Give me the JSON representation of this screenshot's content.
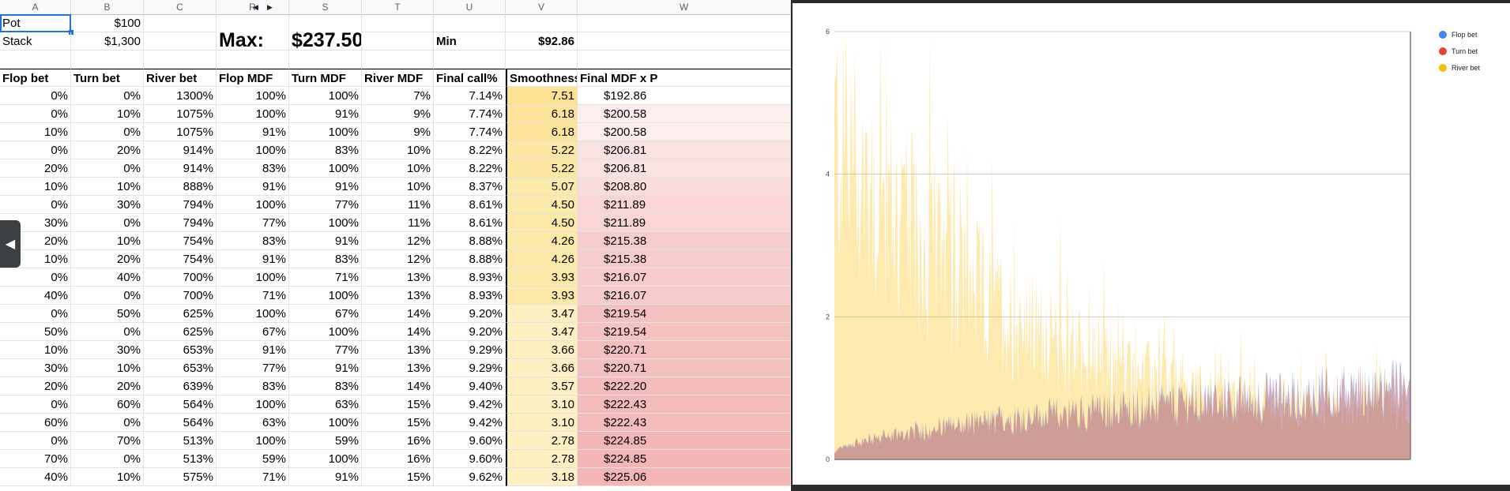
{
  "sheet": {
    "col_headers": [
      "A",
      "B",
      "C",
      "R",
      "S",
      "T",
      "U",
      "V",
      "W"
    ],
    "pot_label": "Pot",
    "pot_value": "$100",
    "stack_label": "Stack",
    "stack_value": "$1,300",
    "max_label": "Max:",
    "max_value": "$237.50",
    "min_label": "Min",
    "min_value": "$92.86",
    "table_headers": [
      "Flop bet",
      "Turn bet",
      "River bet",
      "Flop MDF",
      "Turn MDF",
      "River MDF",
      "Final call%",
      "Smoothness",
      "Final MDF x P"
    ],
    "rows": [
      [
        "0%",
        "0%",
        "1300%",
        "100%",
        "100%",
        "7%",
        "7.14%",
        "7.51",
        "$192.86"
      ],
      [
        "0%",
        "10%",
        "1075%",
        "100%",
        "91%",
        "9%",
        "7.74%",
        "6.18",
        "$200.58"
      ],
      [
        "10%",
        "0%",
        "1075%",
        "91%",
        "100%",
        "9%",
        "7.74%",
        "6.18",
        "$200.58"
      ],
      [
        "0%",
        "20%",
        "914%",
        "100%",
        "83%",
        "10%",
        "8.22%",
        "5.22",
        "$206.81"
      ],
      [
        "20%",
        "0%",
        "914%",
        "83%",
        "100%",
        "10%",
        "8.22%",
        "5.22",
        "$206.81"
      ],
      [
        "10%",
        "10%",
        "888%",
        "91%",
        "91%",
        "10%",
        "8.37%",
        "5.07",
        "$208.80"
      ],
      [
        "0%",
        "30%",
        "794%",
        "100%",
        "77%",
        "11%",
        "8.61%",
        "4.50",
        "$211.89"
      ],
      [
        "30%",
        "0%",
        "794%",
        "77%",
        "100%",
        "11%",
        "8.61%",
        "4.50",
        "$211.89"
      ],
      [
        "20%",
        "10%",
        "754%",
        "83%",
        "91%",
        "12%",
        "8.88%",
        "4.26",
        "$215.38"
      ],
      [
        "10%",
        "20%",
        "754%",
        "91%",
        "83%",
        "12%",
        "8.88%",
        "4.26",
        "$215.38"
      ],
      [
        "0%",
        "40%",
        "700%",
        "100%",
        "71%",
        "13%",
        "8.93%",
        "3.93",
        "$216.07"
      ],
      [
        "40%",
        "0%",
        "700%",
        "71%",
        "100%",
        "13%",
        "8.93%",
        "3.93",
        "$216.07"
      ],
      [
        "0%",
        "50%",
        "625%",
        "100%",
        "67%",
        "14%",
        "9.20%",
        "3.47",
        "$219.54"
      ],
      [
        "50%",
        "0%",
        "625%",
        "67%",
        "100%",
        "14%",
        "9.20%",
        "3.47",
        "$219.54"
      ],
      [
        "10%",
        "30%",
        "653%",
        "91%",
        "77%",
        "13%",
        "9.29%",
        "3.66",
        "$220.71"
      ],
      [
        "30%",
        "10%",
        "653%",
        "77%",
        "91%",
        "13%",
        "9.29%",
        "3.66",
        "$220.71"
      ],
      [
        "20%",
        "20%",
        "639%",
        "83%",
        "83%",
        "14%",
        "9.40%",
        "3.57",
        "$222.20"
      ],
      [
        "0%",
        "60%",
        "564%",
        "100%",
        "63%",
        "15%",
        "9.42%",
        "3.10",
        "$222.43"
      ],
      [
        "60%",
        "0%",
        "564%",
        "63%",
        "100%",
        "15%",
        "9.42%",
        "3.10",
        "$222.43"
      ],
      [
        "0%",
        "70%",
        "513%",
        "100%",
        "59%",
        "16%",
        "9.60%",
        "2.78",
        "$224.85"
      ],
      [
        "70%",
        "0%",
        "513%",
        "59%",
        "100%",
        "16%",
        "9.60%",
        "2.78",
        "$224.85"
      ],
      [
        "40%",
        "10%",
        "575%",
        "71%",
        "91%",
        "15%",
        "9.62%",
        "3.18",
        "$225.06"
      ]
    ],
    "smooth_colors": [
      "#fde293",
      "#fee49a",
      "#fee49a",
      "#fee6a3",
      "#fee6a3",
      "#feeaa8",
      "#feeaa8",
      "#feeaa8",
      "#feeaa8",
      "#feeaa8",
      "#feeaa8",
      "#feeaa8",
      "#fef0c3",
      "#fef0c3",
      "#fef0c3",
      "#fef0c3",
      "#fef0c3",
      "#fef0c3",
      "#fef0c3",
      "#fef0c3",
      "#fef0c3",
      "#fef0c3"
    ],
    "mdf_colors": [
      "#ffffff",
      "#fdeeee",
      "#fdeeee",
      "#fbe2e2",
      "#fbe2e2",
      "#fadcdc",
      "#f9d5d5",
      "#f9d5d5",
      "#f7cccc",
      "#f7cccc",
      "#f7cbcb",
      "#f7cbcb",
      "#f5c2c2",
      "#f5c2c2",
      "#f4bfbf",
      "#f4bfbf",
      "#f4bcbc",
      "#f4bbbb",
      "#f4bbbb",
      "#f3b6b6",
      "#f3b6b6",
      "#f3b5b5"
    ]
  },
  "chart_data": {
    "type": "area",
    "ylim": [
      0,
      6
    ],
    "yticks": [
      "0",
      "2",
      "4",
      "6"
    ],
    "grid": true,
    "legend_position": "top-right",
    "n_points": 600,
    "series": [
      {
        "name": "Flop bet",
        "color": "#4285f4"
      },
      {
        "name": "Turn bet",
        "color": "#ea4335"
      },
      {
        "name": "River bet",
        "color": "#fbbc04"
      }
    ]
  }
}
